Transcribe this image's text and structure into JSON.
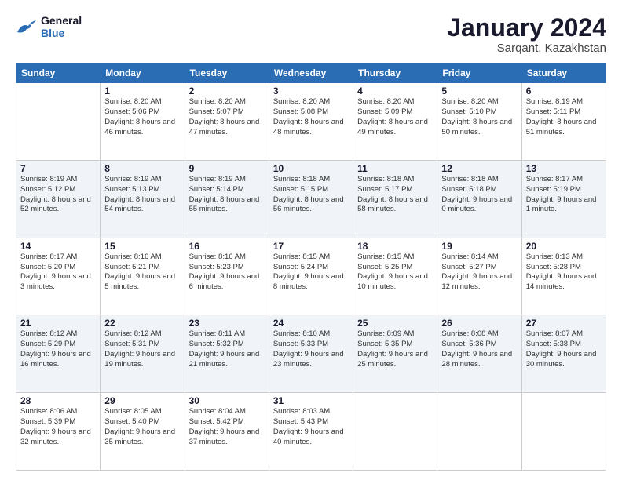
{
  "logo": {
    "line1": "General",
    "line2": "Blue"
  },
  "header": {
    "month": "January 2024",
    "location": "Sarqant, Kazakhstan"
  },
  "weekdays": [
    "Sunday",
    "Monday",
    "Tuesday",
    "Wednesday",
    "Thursday",
    "Friday",
    "Saturday"
  ],
  "weeks": [
    [
      {
        "day": "",
        "sunrise": "",
        "sunset": "",
        "daylight": ""
      },
      {
        "day": "1",
        "sunrise": "Sunrise: 8:20 AM",
        "sunset": "Sunset: 5:06 PM",
        "daylight": "Daylight: 8 hours and 46 minutes."
      },
      {
        "day": "2",
        "sunrise": "Sunrise: 8:20 AM",
        "sunset": "Sunset: 5:07 PM",
        "daylight": "Daylight: 8 hours and 47 minutes."
      },
      {
        "day": "3",
        "sunrise": "Sunrise: 8:20 AM",
        "sunset": "Sunset: 5:08 PM",
        "daylight": "Daylight: 8 hours and 48 minutes."
      },
      {
        "day": "4",
        "sunrise": "Sunrise: 8:20 AM",
        "sunset": "Sunset: 5:09 PM",
        "daylight": "Daylight: 8 hours and 49 minutes."
      },
      {
        "day": "5",
        "sunrise": "Sunrise: 8:20 AM",
        "sunset": "Sunset: 5:10 PM",
        "daylight": "Daylight: 8 hours and 50 minutes."
      },
      {
        "day": "6",
        "sunrise": "Sunrise: 8:19 AM",
        "sunset": "Sunset: 5:11 PM",
        "daylight": "Daylight: 8 hours and 51 minutes."
      }
    ],
    [
      {
        "day": "7",
        "sunrise": "Sunrise: 8:19 AM",
        "sunset": "Sunset: 5:12 PM",
        "daylight": "Daylight: 8 hours and 52 minutes."
      },
      {
        "day": "8",
        "sunrise": "Sunrise: 8:19 AM",
        "sunset": "Sunset: 5:13 PM",
        "daylight": "Daylight: 8 hours and 54 minutes."
      },
      {
        "day": "9",
        "sunrise": "Sunrise: 8:19 AM",
        "sunset": "Sunset: 5:14 PM",
        "daylight": "Daylight: 8 hours and 55 minutes."
      },
      {
        "day": "10",
        "sunrise": "Sunrise: 8:18 AM",
        "sunset": "Sunset: 5:15 PM",
        "daylight": "Daylight: 8 hours and 56 minutes."
      },
      {
        "day": "11",
        "sunrise": "Sunrise: 8:18 AM",
        "sunset": "Sunset: 5:17 PM",
        "daylight": "Daylight: 8 hours and 58 minutes."
      },
      {
        "day": "12",
        "sunrise": "Sunrise: 8:18 AM",
        "sunset": "Sunset: 5:18 PM",
        "daylight": "Daylight: 9 hours and 0 minutes."
      },
      {
        "day": "13",
        "sunrise": "Sunrise: 8:17 AM",
        "sunset": "Sunset: 5:19 PM",
        "daylight": "Daylight: 9 hours and 1 minute."
      }
    ],
    [
      {
        "day": "14",
        "sunrise": "Sunrise: 8:17 AM",
        "sunset": "Sunset: 5:20 PM",
        "daylight": "Daylight: 9 hours and 3 minutes."
      },
      {
        "day": "15",
        "sunrise": "Sunrise: 8:16 AM",
        "sunset": "Sunset: 5:21 PM",
        "daylight": "Daylight: 9 hours and 5 minutes."
      },
      {
        "day": "16",
        "sunrise": "Sunrise: 8:16 AM",
        "sunset": "Sunset: 5:23 PM",
        "daylight": "Daylight: 9 hours and 6 minutes."
      },
      {
        "day": "17",
        "sunrise": "Sunrise: 8:15 AM",
        "sunset": "Sunset: 5:24 PM",
        "daylight": "Daylight: 9 hours and 8 minutes."
      },
      {
        "day": "18",
        "sunrise": "Sunrise: 8:15 AM",
        "sunset": "Sunset: 5:25 PM",
        "daylight": "Daylight: 9 hours and 10 minutes."
      },
      {
        "day": "19",
        "sunrise": "Sunrise: 8:14 AM",
        "sunset": "Sunset: 5:27 PM",
        "daylight": "Daylight: 9 hours and 12 minutes."
      },
      {
        "day": "20",
        "sunrise": "Sunrise: 8:13 AM",
        "sunset": "Sunset: 5:28 PM",
        "daylight": "Daylight: 9 hours and 14 minutes."
      }
    ],
    [
      {
        "day": "21",
        "sunrise": "Sunrise: 8:12 AM",
        "sunset": "Sunset: 5:29 PM",
        "daylight": "Daylight: 9 hours and 16 minutes."
      },
      {
        "day": "22",
        "sunrise": "Sunrise: 8:12 AM",
        "sunset": "Sunset: 5:31 PM",
        "daylight": "Daylight: 9 hours and 19 minutes."
      },
      {
        "day": "23",
        "sunrise": "Sunrise: 8:11 AM",
        "sunset": "Sunset: 5:32 PM",
        "daylight": "Daylight: 9 hours and 21 minutes."
      },
      {
        "day": "24",
        "sunrise": "Sunrise: 8:10 AM",
        "sunset": "Sunset: 5:33 PM",
        "daylight": "Daylight: 9 hours and 23 minutes."
      },
      {
        "day": "25",
        "sunrise": "Sunrise: 8:09 AM",
        "sunset": "Sunset: 5:35 PM",
        "daylight": "Daylight: 9 hours and 25 minutes."
      },
      {
        "day": "26",
        "sunrise": "Sunrise: 8:08 AM",
        "sunset": "Sunset: 5:36 PM",
        "daylight": "Daylight: 9 hours and 28 minutes."
      },
      {
        "day": "27",
        "sunrise": "Sunrise: 8:07 AM",
        "sunset": "Sunset: 5:38 PM",
        "daylight": "Daylight: 9 hours and 30 minutes."
      }
    ],
    [
      {
        "day": "28",
        "sunrise": "Sunrise: 8:06 AM",
        "sunset": "Sunset: 5:39 PM",
        "daylight": "Daylight: 9 hours and 32 minutes."
      },
      {
        "day": "29",
        "sunrise": "Sunrise: 8:05 AM",
        "sunset": "Sunset: 5:40 PM",
        "daylight": "Daylight: 9 hours and 35 minutes."
      },
      {
        "day": "30",
        "sunrise": "Sunrise: 8:04 AM",
        "sunset": "Sunset: 5:42 PM",
        "daylight": "Daylight: 9 hours and 37 minutes."
      },
      {
        "day": "31",
        "sunrise": "Sunrise: 8:03 AM",
        "sunset": "Sunset: 5:43 PM",
        "daylight": "Daylight: 9 hours and 40 minutes."
      },
      {
        "day": "",
        "sunrise": "",
        "sunset": "",
        "daylight": ""
      },
      {
        "day": "",
        "sunrise": "",
        "sunset": "",
        "daylight": ""
      },
      {
        "day": "",
        "sunrise": "",
        "sunset": "",
        "daylight": ""
      }
    ]
  ]
}
